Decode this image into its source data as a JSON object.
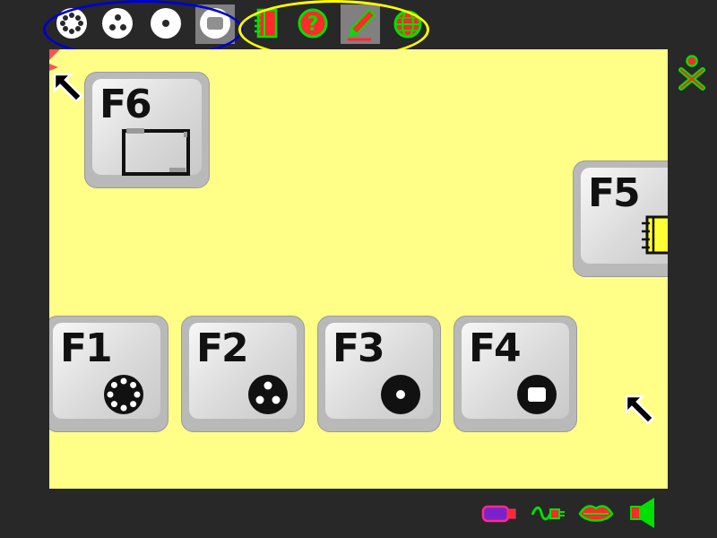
{
  "toolbar": {
    "zoom_group": [
      "neighborhood-view-icon",
      "group-view-icon",
      "home-view-icon",
      "activity-view-icon"
    ],
    "activities": [
      "journal-icon",
      "help-icon",
      "write-icon",
      "browse-icon"
    ],
    "selected_zoom": "activity-view-icon",
    "selected_activity": "write-icon"
  },
  "keys": [
    {
      "label": "F6",
      "icon": "frame-icon"
    },
    {
      "label": "F5",
      "icon": "journal-icon"
    },
    {
      "label": "F1",
      "icon": "neighborhood-view-icon"
    },
    {
      "label": "F2",
      "icon": "group-view-icon"
    },
    {
      "label": "F3",
      "icon": "home-view-icon"
    },
    {
      "label": "F4",
      "icon": "activity-view-icon"
    }
  ],
  "tray": [
    "usb-drive-icon",
    "network-cable-icon",
    "microphone-icon",
    "speaker-icon"
  ],
  "colors": {
    "frame": "#282828",
    "canvas": "#ffff88",
    "accent_green": "#00e000",
    "accent_red": "#ff2a2a",
    "zoom_oval": "#0000d0",
    "activity_oval": "#ffff00"
  }
}
